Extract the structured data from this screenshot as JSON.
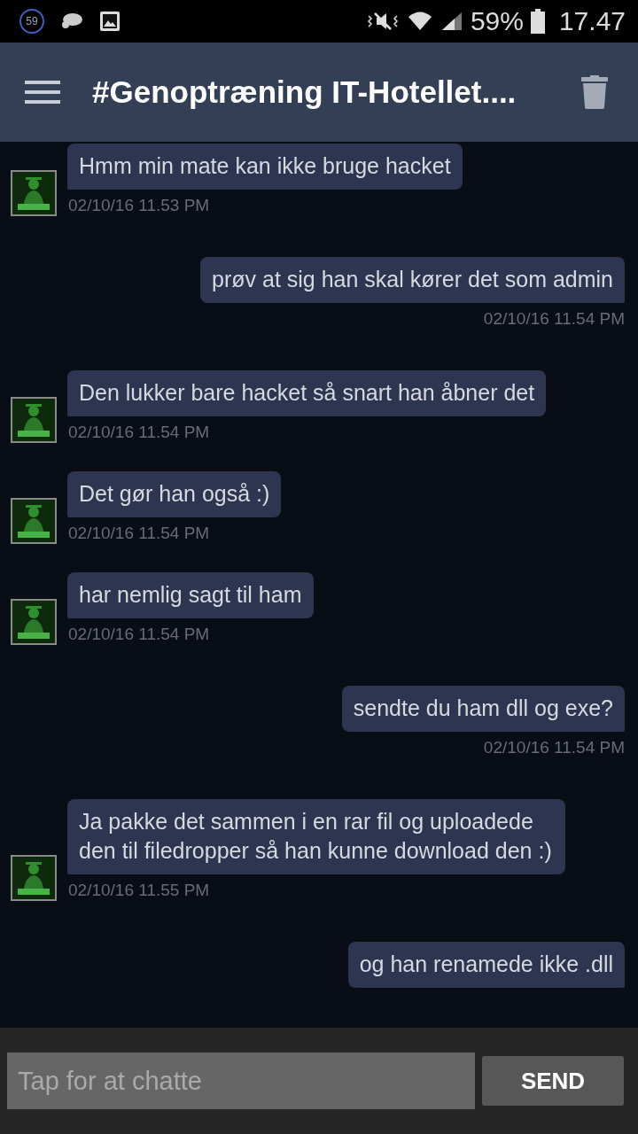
{
  "status_bar": {
    "notification_count": "59",
    "battery": "59%",
    "time": "17.47"
  },
  "app_bar": {
    "title": "#Genoptræning IT-Hotellet...."
  },
  "messages": [
    {
      "kind": "received",
      "text": "Hmm min mate kan ikke bruge hacket",
      "timestamp": "02/10/16 11.53 PM"
    },
    {
      "kind": "sent",
      "text": "prøv at sig han skal kører det som admin",
      "timestamp": "02/10/16 11.54 PM"
    },
    {
      "kind": "received",
      "text": "Den lukker bare hacket så snart han åbner det",
      "timestamp": "02/10/16 11.54 PM"
    },
    {
      "kind": "received",
      "text": "Det gør han også :)",
      "timestamp": "02/10/16 11.54 PM"
    },
    {
      "kind": "received",
      "text": "har nemlig sagt til ham",
      "timestamp": "02/10/16 11.54 PM"
    },
    {
      "kind": "sent",
      "text": "sendte du ham dll og exe?",
      "timestamp": "02/10/16 11.54 PM"
    },
    {
      "kind": "received",
      "text": "Ja pakke det sammen i en rar fil og uploadede den til filedropper så han kunne download den :)",
      "timestamp": "02/10/16 11.55 PM"
    },
    {
      "kind": "sent",
      "text": "og han renamede ikke .dll"
    }
  ],
  "composer": {
    "placeholder": "Tap for at chatte",
    "send_label": "SEND"
  }
}
